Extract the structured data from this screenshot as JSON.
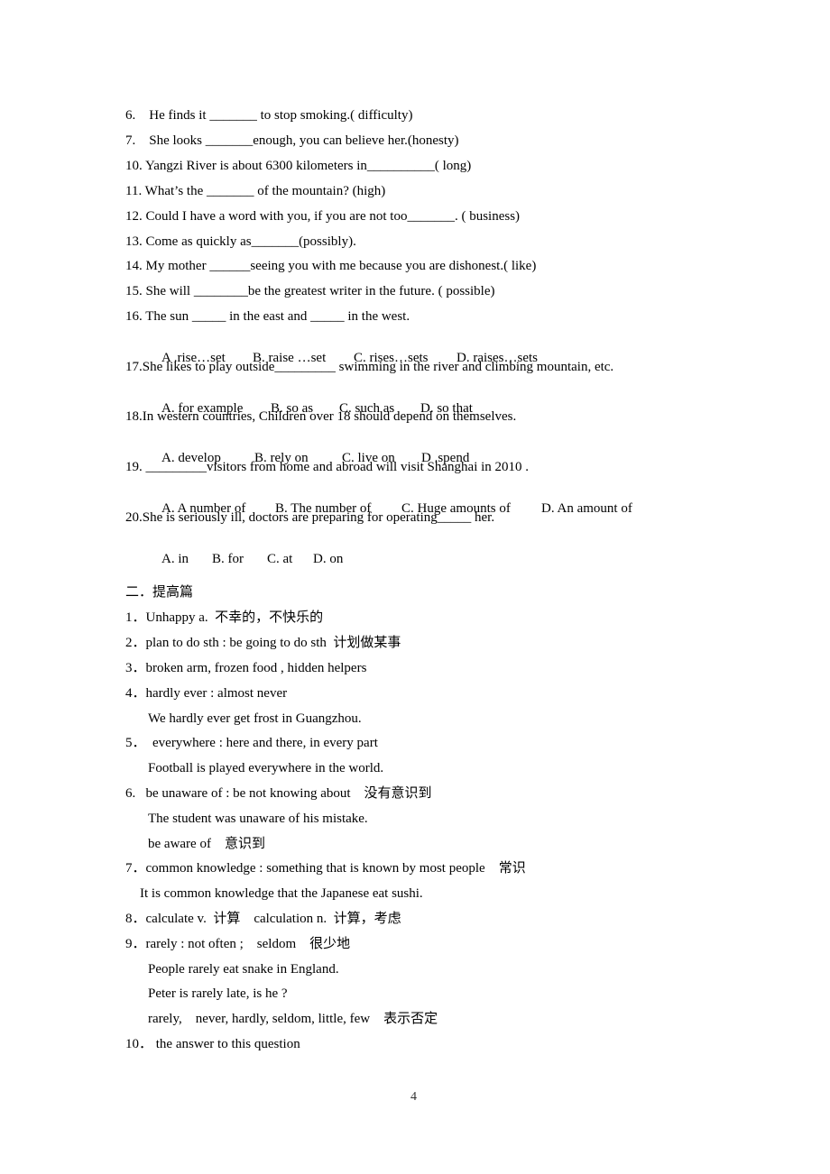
{
  "exercises": [
    {
      "text": "6.    He finds it _______ to stop smoking.( difficulty)"
    },
    {
      "text": "7.    She looks _______enough, you can believe her.(honesty)"
    },
    {
      "text": "10. Yangzi River is about 6300 kilometers in__________( long)"
    },
    {
      "text": "11. What’s the _______ of the mountain? (high)"
    },
    {
      "text": "12. Could I have a word with you, if you are not too_______. ( business)"
    },
    {
      "text": "13. Come as quickly as_______(possibly)."
    },
    {
      "text": "14. My mother ______seeing you with me because you are dishonest.( like)"
    },
    {
      "text": "15. She will ________be the greatest writer in the future. ( possible)"
    },
    {
      "text": "16. The sun _____ in the east and _____ in the west.",
      "options": [
        "A .rise…set",
        "B. raise …set",
        "C. rises…sets",
        "D. raises…sets"
      ]
    },
    {
      "text": "17.She likes to play outside_________ swimming in the river and climbing mountain, etc.",
      "options": [
        "A. for example",
        "B. so as",
        "C. such as",
        "D. so that"
      ]
    },
    {
      "text": "18.In western countries, Children over 18 should depend on themselves.",
      "options": [
        "A. develop",
        "B. rely on",
        "C. live on",
        "D .spend"
      ]
    },
    {
      "text": "19. _________visitors from home and abroad will visit Shanghai in 2010 .",
      "options": [
        "A. A number of",
        "B. The number of",
        "C. Huge amounts of",
        "D. An amount of"
      ]
    },
    {
      "text": "20.She is seriously ill, doctors are preparing for operating_____ her.",
      "options": [
        "A. in",
        "B. for",
        "C. at",
        "D. on"
      ]
    }
  ],
  "section2": {
    "heading": "二．提高篇",
    "lines": [
      "1．Unhappy a.  不幸的，不快乐的",
      "2．plan to do sth : be going to do sth  计划做某事",
      "3．broken arm, frozen food , hidden helpers",
      "4．hardly ever : almost never",
      "We hardly ever get frost in Guangzhou.",
      "5．  everywhere : here and there, in every part",
      "Football is played everywhere in the world.",
      "6.   be unaware of : be not knowing about    没有意识到",
      "The student was unaware of his mistake.",
      "be aware of    意识到",
      "7．common knowledge : something that is known by most people    常识",
      "It is common knowledge that the Japanese eat sushi.",
      "8．calculate v.  计算    calculation n.  计算，考虑",
      "9．rarely : not often ;    seldom    很少地",
      "People rarely eat snake in England.",
      "Peter is rarely late, is he ?",
      "rarely,    never, hardly, seldom, little, few    表示否定",
      "10． the answer to this question"
    ]
  },
  "page_number": "4"
}
